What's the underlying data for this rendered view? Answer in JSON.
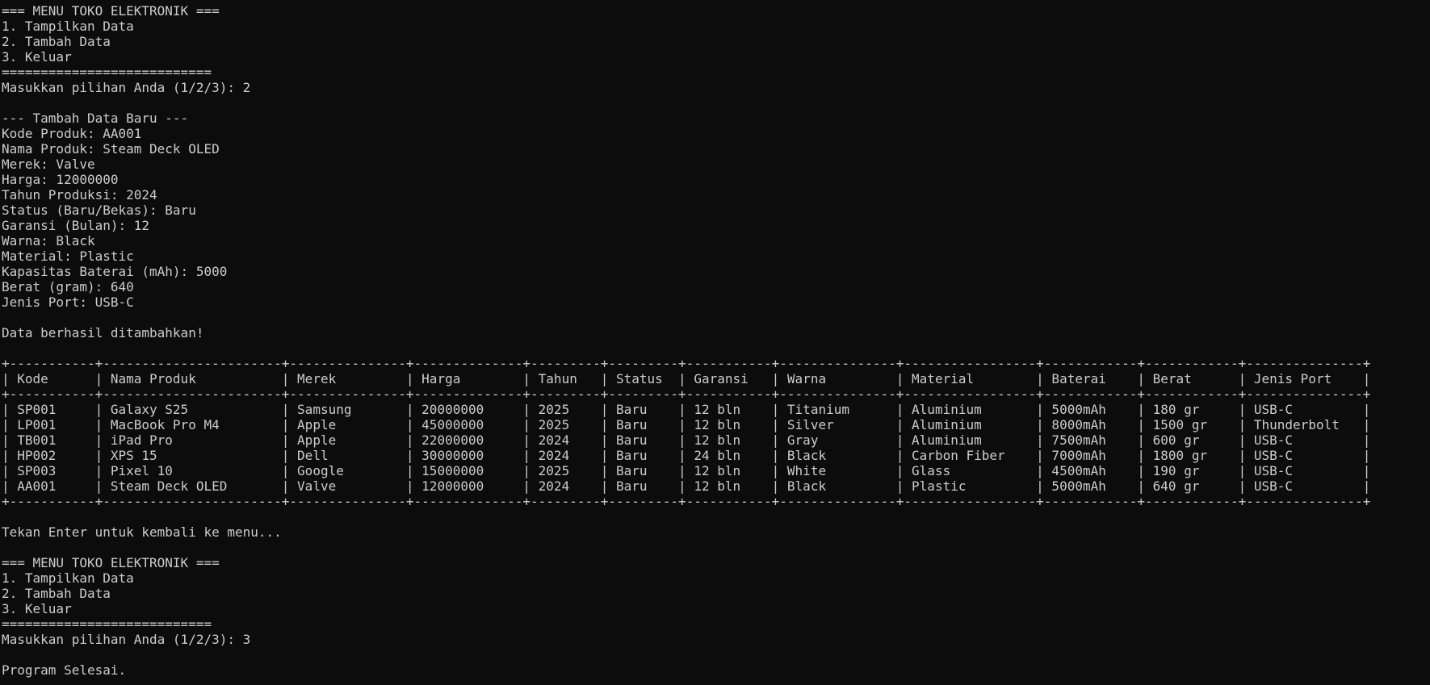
{
  "menu_first": {
    "title": "=== MENU TOKO ELEKTRONIK ===",
    "items": [
      "1. Tampilkan Data",
      "2. Tambah Data",
      "3. Keluar"
    ],
    "separator": "===========================",
    "prompt": "Masukkan pilihan Anda (1/2/3): 2"
  },
  "add_form": {
    "header": "--- Tambah Data Baru ---",
    "fields": [
      "Kode Produk: AA001",
      "Nama Produk: Steam Deck OLED",
      "Merek: Valve",
      "Harga: 12000000",
      "Tahun Produksi: 2024",
      "Status (Baru/Bekas): Baru",
      "Garansi (Bulan): 12",
      "Warna: Black",
      "Material: Plastic",
      "Kapasitas Baterai (mAh): 5000",
      "Berat (gram): 640",
      "Jenis Port: USB-C"
    ],
    "success": "Data berhasil ditambahkan!"
  },
  "table": {
    "border": "+-----------+-----------------------+---------------+--------------+---------+---------+-----------+---------------+-----------------+------------+------------+---------------+",
    "header_row": "| Kode      | Nama Produk           | Merek         | Harga        | Tahun   | Status  | Garansi   | Warna         | Material        | Baterai    | Berat      | Jenis Port    |",
    "rows": [
      "| SP001     | Galaxy S25            | Samsung       | 20000000     | 2025    | Baru    | 12 bln    | Titanium      | Aluminium       | 5000mAh    | 180 gr     | USB-C         |",
      "| LP001     | MacBook Pro M4        | Apple         | 45000000     | 2025    | Baru    | 12 bln    | Silver        | Aluminium       | 8000mAh    | 1500 gr    | Thunderbolt   |",
      "| TB001     | iPad Pro              | Apple         | 22000000     | 2024    | Baru    | 12 bln    | Gray          | Aluminium       | 7500mAh    | 600 gr     | USB-C         |",
      "| HP002     | XPS 15                | Dell          | 30000000     | 2024    | Baru    | 24 bln    | Black         | Carbon Fiber    | 7000mAh    | 1800 gr    | USB-C         |",
      "| SP003     | Pixel 10              | Google        | 15000000     | 2025    | Baru    | 12 bln    | White         | Glass           | 4500mAh    | 190 gr     | USB-C         |",
      "| AA001     | Steam Deck OLED       | Valve         | 12000000     | 2024    | Baru    | 12 bln    | Black         | Plastic         | 5000mAh    | 640 gr     | USB-C         |"
    ]
  },
  "return_prompt": "Tekan Enter untuk kembali ke menu...",
  "menu_second": {
    "title": "=== MENU TOKO ELEKTRONIK ===",
    "items": [
      "1. Tampilkan Data",
      "2. Tambah Data",
      "3. Keluar"
    ],
    "separator": "===========================",
    "prompt": "Masukkan pilihan Anda (1/2/3): 3"
  },
  "end_message": "Program Selesai."
}
